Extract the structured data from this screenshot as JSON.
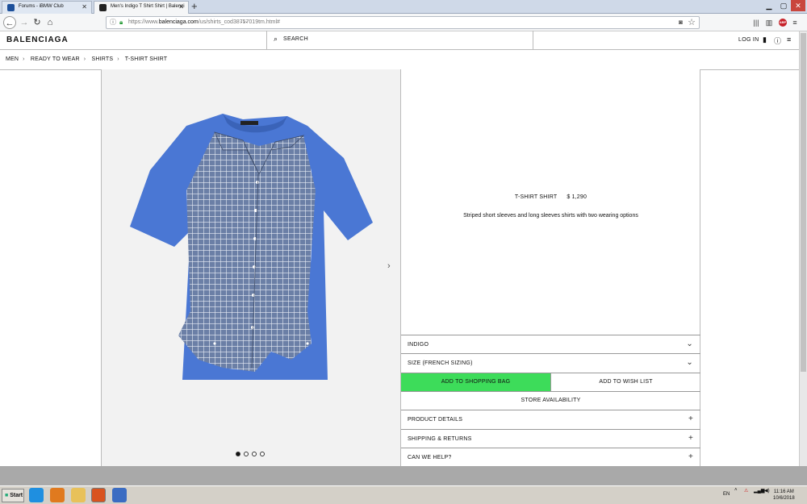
{
  "browser": {
    "tabs": [
      {
        "title": "Forums - iBMW Club",
        "active": false
      },
      {
        "title": "Men's Indigo T Shirt Shirt | Balenci",
        "active": true
      }
    ],
    "new_tab_label": "+",
    "url_prefix": "https://www.",
    "url_domain": "balenciaga.com",
    "url_path": "/us/shirts_cod38757019tm.html#",
    "url_more": "···"
  },
  "site": {
    "logo": "BALENCIAGA",
    "search_label": "SEARCH",
    "login_label": "LOG IN"
  },
  "breadcrumb": [
    "MEN",
    "READY TO WEAR",
    "SHIRTS",
    "T-SHIRT SHIRT"
  ],
  "product": {
    "name": "T-SHIRT SHIRT",
    "price": "$ 1,290",
    "description": "Striped short sleeves and long sleeves shirts with two wearing options",
    "color_label": "INDIGO",
    "size_label": "SIZE (FRENCH SIZING)",
    "add_to_bag": "ADD TO SHOPPING BAG",
    "add_to_wishlist": "ADD TO WISH LIST",
    "store_availability": "STORE AVAILABILITY",
    "sections": [
      "PRODUCT DETAILS",
      "SHIPPING & RETURNS",
      "CAN WE HELP?"
    ]
  },
  "gallery": {
    "image_count": 4,
    "current_index": 1
  },
  "colors": {
    "accent_green": "#3ddc5a",
    "shirt_blue": "#4a77d4",
    "check_blue": "#5a6f95"
  },
  "taskbar": {
    "start_label": "Start",
    "language": "EN",
    "time": "11:16 AM",
    "date": "10/6/2018"
  }
}
